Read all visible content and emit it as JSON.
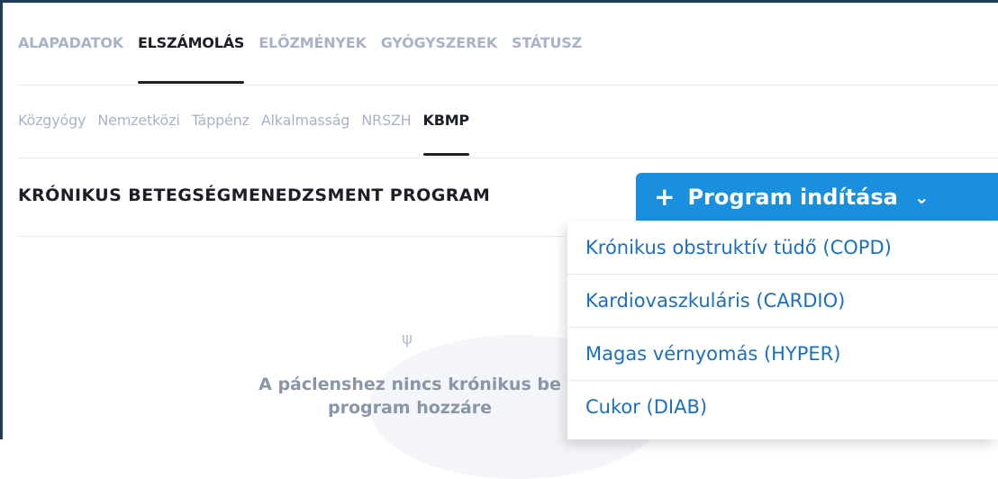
{
  "main_tabs": [
    {
      "label": "ALAPADATOK",
      "active": false
    },
    {
      "label": "ELSZÁMOLÁS",
      "active": true
    },
    {
      "label": "ELŐZMÉNYEK",
      "active": false
    },
    {
      "label": "GYÓGYSZEREK",
      "active": false
    },
    {
      "label": "STÁTUSZ",
      "active": false
    }
  ],
  "sub_tabs": [
    {
      "label": "Közgyógy",
      "active": false
    },
    {
      "label": "Nemzetközi",
      "active": false
    },
    {
      "label": "Táppénz",
      "active": false
    },
    {
      "label": "Alkalmasság",
      "active": false
    },
    {
      "label": "NRSZH",
      "active": false
    },
    {
      "label": "KBMP",
      "active": true
    }
  ],
  "section": {
    "title": "KRÓNIKUS BETEGSÉGMENEDZSMENT PROGRAM"
  },
  "start_button": {
    "label": "Program indítása",
    "plus": "+",
    "chevron": "⌄",
    "color": "#1a8fdd"
  },
  "dropdown": {
    "items": [
      "Krónikus obstruktív tüdő (COPD)",
      "Kardiovaszkuláris (CARDIO)",
      "Magas vérnyomás (HYPER)",
      "Cukor (DIAB)"
    ]
  },
  "empty_state": {
    "icon": "cactus-icon",
    "line1": "A páclenshez nincs krónikus be",
    "line2": "program hozzáre"
  }
}
